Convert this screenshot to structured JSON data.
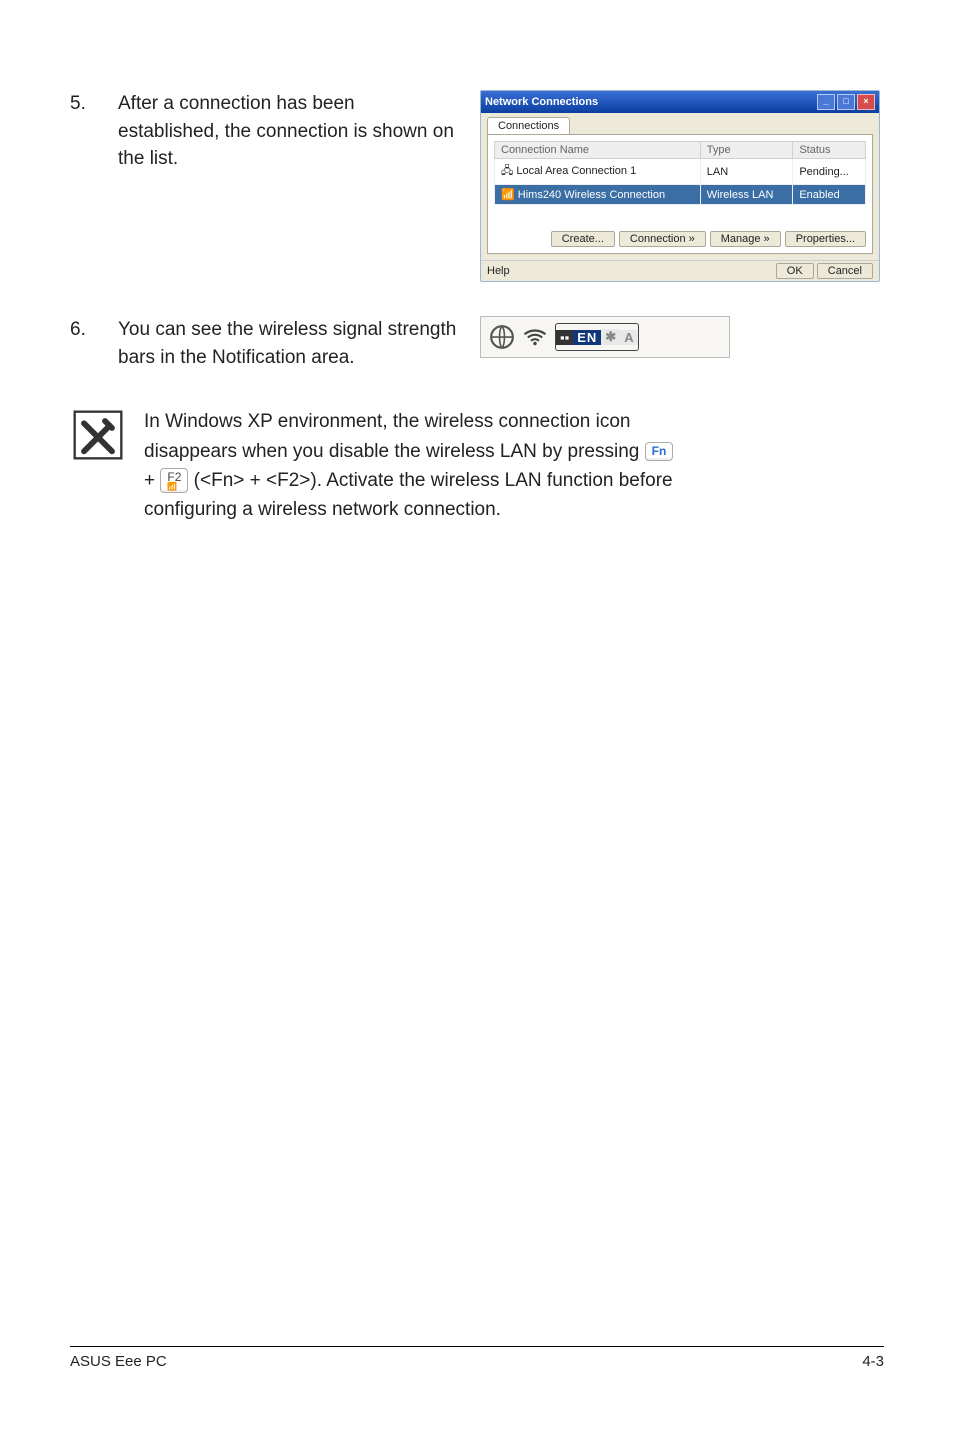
{
  "step5": {
    "num": "5.",
    "text": "After a connection has been established, the connection is shown on the list."
  },
  "step6": {
    "num": "6.",
    "text": "You can see the wireless signal strength bars in the Notification area."
  },
  "win": {
    "title": "Network Connections",
    "tab": "Connections",
    "cols": [
      "Connection Name",
      "Type",
      "Status"
    ],
    "rows": [
      [
        "Local Area Connection 1",
        "LAN",
        "Pending..."
      ],
      [
        "Hims240 Wireless Connection",
        "Wireless LAN",
        "Enabled"
      ]
    ],
    "btns": [
      "Create...",
      "Connection »",
      "Manage »",
      "Properties..."
    ],
    "status_left": "Help",
    "status_ok": "OK",
    "status_cancel": "Cancel"
  },
  "tray": {
    "lang": "EN"
  },
  "note": {
    "l1": "In Windows XP environment, the wireless connection icon",
    "l2a": "disappears when you disable the wireless LAN by pressing ",
    "l3a": " + ",
    "l3b": " (<Fn> + <F2>). Activate the wireless LAN function before",
    "l4": "configuring a wireless network connection.",
    "key_fn": "Fn",
    "key_f2_top": "F2",
    "key_f2_bot": "📶"
  },
  "footer": {
    "left": "ASUS Eee PC",
    "right": "4-3"
  }
}
